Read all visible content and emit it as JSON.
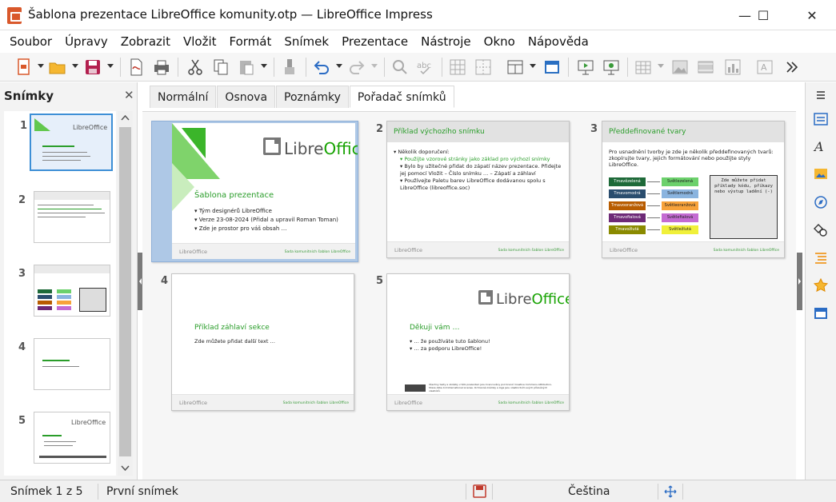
{
  "window": {
    "title": "Šablona prezentace LibreOffice komunity.otp — LibreOffice Impress",
    "min": "—",
    "max": "☐",
    "close": "✕"
  },
  "menu": [
    "Soubor",
    "Úpravy",
    "Zobrazit",
    "Vložit",
    "Formát",
    "Snímek",
    "Prezentace",
    "Nástroje",
    "Okno",
    "Nápověda"
  ],
  "slides_panel": {
    "title": "Snímky",
    "close": "✕",
    "thumb_numbers": [
      "1",
      "2",
      "3",
      "4",
      "5"
    ]
  },
  "tabs": [
    "Normální",
    "Osnova",
    "Poznámky",
    "Pořadač snímků"
  ],
  "slides": [
    {
      "num": "1",
      "title": "Šablona prezentace",
      "logo_a": "Libre",
      "logo_b": "Office",
      "bullets": [
        "Tým designérů LibreOffice",
        "Verze 23-08-2024 (Přidal a upravil Roman Toman)",
        "Zde je prostor pro váš obsah …"
      ],
      "foot_logo": "LibreOffice",
      "foot_text": "Sada komunitních šablon LibreOffice"
    },
    {
      "num": "2",
      "title": "Příklad výchozího snímku",
      "bullets": [
        "Několik doporučení:",
        "Použijte vzorové stránky jako základ pro výchozí snímky",
        "Bylo by užitečné přidat do zápatí název prezentace. Přidejte jej pomocí Vložit – Číslo snímku … – Zápatí a záhlaví",
        "Používejte Paletu barev LibreOffice dodávanou spolu s LibreOffice (libreoffice.soc)"
      ],
      "foot_logo": "LibreOffice",
      "foot_text": "Sada komunitních šablon LibreOffice"
    },
    {
      "num": "3",
      "title": "Předdefinované tvary",
      "intro": "Pro usnadnění tvorby je zde je několik předdefinovaných tvarů: zkopírujte tvary, jejich formátování nebo použijte styly LibreOffice.",
      "shapes_left": [
        "Tmavězelená",
        "Tmavomodrá",
        "Tmavooranžová",
        "Tmavofialová",
        "Tmavožlutá"
      ],
      "shapes_right": [
        "Světlezelená",
        "Světlemodrá",
        "Světleoranžová",
        "Světlefialová",
        "Světležlutá"
      ],
      "code_box": "Zde můžete přidat příklady kódu, příkazy nebo výstup ladění (-)",
      "foot_logo": "LibreOffice",
      "foot_text": "Sada komunitních šablon LibreOffice"
    },
    {
      "num": "4",
      "title": "Příklad záhlaví sekce",
      "body": "Zde můžete přidat další text …",
      "foot_logo": "LibreOffice",
      "foot_text": "Sada komunitních šablon LibreOffice"
    },
    {
      "num": "5",
      "title": "Děkuji vám …",
      "logo_a": "Libre",
      "logo_b": "Office",
      "bullets": [
        "… že používáte tuto šablonu!",
        "… za podporu LibreOffice!"
      ],
      "license": "Všechny texty a obrázky v této prezentaci jsou licencovány pod licencí Creative Commons Attribution-Share Alike 4.0 International License. Ochranné známky a loga jsou vlastnictvím svých příslušných vlastníků.",
      "foot_logo": "LibreOffice",
      "foot_text": "Sada komunitních šablon LibreOffice"
    }
  ],
  "colors": {
    "dark": [
      "#1e6a39",
      "#2a4d6e",
      "#b85c00",
      "#6e2a77",
      "#8a8a00"
    ],
    "light": [
      "#6cd16c",
      "#8ab4df",
      "#f7a23a",
      "#c46bd2",
      "#f0f03a"
    ],
    "accent": "#18a303"
  },
  "status": {
    "slide": "Snímek 1 z 5",
    "layout": "První snímek",
    "language": "Čeština"
  }
}
